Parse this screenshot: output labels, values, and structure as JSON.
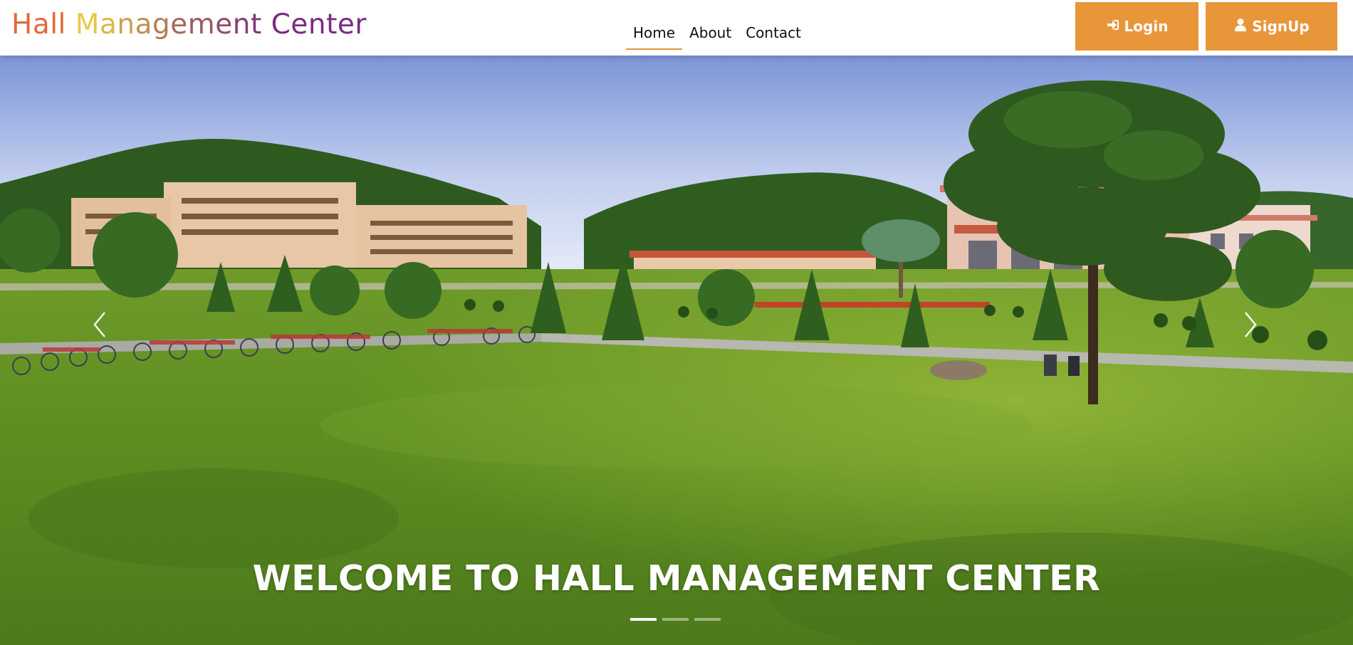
{
  "brand": {
    "parts": [
      {
        "text": "Hall ",
        "color": "#e06a3b"
      },
      {
        "text": "M",
        "color": "#e8c64a"
      },
      {
        "text": "a",
        "color": "#d9b84a"
      },
      {
        "text": "n",
        "color": "#c9a24b"
      },
      {
        "text": "a",
        "color": "#c08f4e"
      },
      {
        "text": "g",
        "color": "#b47c52"
      },
      {
        "text": "e",
        "color": "#a66a58"
      },
      {
        "text": "m",
        "color": "#9b5a60"
      },
      {
        "text": "e",
        "color": "#914d68"
      },
      {
        "text": "n",
        "color": "#88406f"
      },
      {
        "text": "t ",
        "color": "#813677"
      },
      {
        "text": "Center",
        "color": "#7b2a83"
      }
    ]
  },
  "nav": {
    "items": [
      {
        "label": "Home",
        "active": true
      },
      {
        "label": "About",
        "active": false
      },
      {
        "label": "Contact",
        "active": false
      }
    ],
    "active_underline_color": "#e8963a"
  },
  "auth": {
    "login_label": "Login",
    "login_icon": "sign-in-icon",
    "signup_label": "SignUp",
    "signup_icon": "user-icon",
    "button_color": "#e8963a"
  },
  "carousel": {
    "caption": "WELCOME TO HALL MANAGEMENT CENTER",
    "prev_icon": "chevron-left-icon",
    "next_icon": "chevron-right-icon",
    "slide_count": 3,
    "active_slide": 1
  }
}
